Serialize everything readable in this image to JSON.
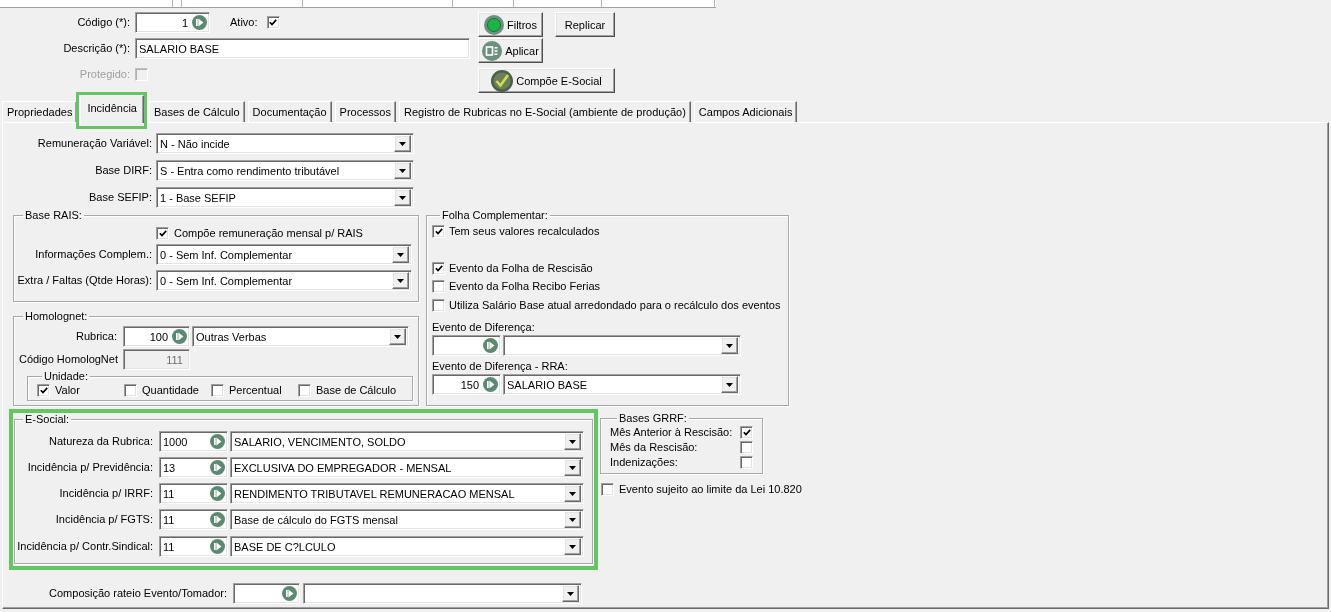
{
  "record": {
    "code": {
      "label": "Código (*):",
      "value": "1"
    },
    "active": {
      "label": "Ativo:",
      "checked": true
    },
    "description": {
      "label": "Descrição (*):",
      "value": "SALARIO BASE"
    },
    "protected": {
      "label": "Protegido:",
      "checked": false,
      "disabled": true
    }
  },
  "buttons": [
    {
      "label": "Filtros",
      "kind": "filter"
    },
    {
      "label": "Replicar",
      "kind": "plain"
    },
    {
      "label": "Aplicar",
      "kind": "apply"
    },
    {
      "label": "Compõe E-Social",
      "kind": "esocial"
    }
  ],
  "tabs": [
    {
      "label": "Propriedades",
      "selected": false,
      "highlighted": false
    },
    {
      "label": "Incidência",
      "selected": true,
      "highlighted": true
    },
    {
      "label": "Bases de Cálculo",
      "selected": false,
      "highlighted": false
    },
    {
      "label": "Documentação",
      "selected": false,
      "highlighted": false
    },
    {
      "label": "Processos",
      "selected": false,
      "highlighted": false
    },
    {
      "label": "Registro de Rubricas no E-Social (ambiente de produção)",
      "selected": false,
      "highlighted": false
    },
    {
      "label": "Campos Adicionais",
      "selected": false,
      "highlighted": false
    }
  ],
  "incidence": {
    "selects": [
      {
        "label": "Remuneração Variável:",
        "value": "N - Não incide"
      },
      {
        "label": "Base DIRF:",
        "value": "S - Entra como rendimento tributável"
      },
      {
        "label": "Base SEFIP:",
        "value": "1 - Base SEFIP"
      }
    ],
    "base_rais": {
      "title": "Base RAIS:",
      "checkbox": {
        "label": "Compõe remuneração mensal p/ RAIS",
        "checked": true
      },
      "selects": [
        {
          "label": "Informações Complem.:",
          "value": "0 - Sem Inf. Complementar"
        },
        {
          "label": "Extra / Faltas (Qtde Horas):",
          "value": "0 - Sem Inf. Complementar"
        }
      ]
    },
    "homolognet": {
      "title": "Homolognet:",
      "rubrica": {
        "label": "Rubrica:",
        "code": "100",
        "value": "Outras Verbas"
      },
      "homolognet_code": {
        "label": "Código HomologNet",
        "value": "111",
        "disabled": true
      },
      "unit": {
        "title": "Unidade:",
        "options": [
          {
            "label": "Valor",
            "checked": true
          },
          {
            "label": "Quantidade",
            "checked": false
          },
          {
            "label": "Percentual",
            "checked": false
          },
          {
            "label": "Base de Cálculo",
            "checked": false
          }
        ]
      }
    },
    "folha_complementar": {
      "title": "Folha Complementar:",
      "options": [
        {
          "label": "Tem seus valores recalculados",
          "checked": true
        },
        {
          "label": "Evento da Folha de Rescisão",
          "checked": true
        },
        {
          "label": "Evento da Folha Recibo Ferias",
          "checked": false
        },
        {
          "label": "Utiliza Salário Base atual arredondado para o recálculo dos eventos",
          "checked": false
        }
      ],
      "lookups": [
        {
          "label": "Evento de Diferença:"
        },
        {
          "label": "Evento de Diferença - RRA:",
          "code": "150",
          "value": "SALARIO BASE"
        }
      ]
    },
    "esocial": {
      "title": "E-Social:",
      "highlighted": true,
      "rows": [
        {
          "label": "Natureza da Rubrica:",
          "code": "1000",
          "value": "SALARIO, VENCIMENTO, SOLDO"
        },
        {
          "label": "Incidência p/ Previdência:",
          "code": "13",
          "value": "EXCLUSIVA DO EMPREGADOR - MENSAL"
        },
        {
          "label": "Incidência p/ IRRF:",
          "code": "11",
          "value": "RENDIMENTO TRIBUTAVEL REMUNERACAO MENSAL"
        },
        {
          "label": "Incidência p/ FGTS:",
          "code": "11",
          "value": "Base de cálculo do FGTS mensal"
        },
        {
          "label": "Incidência p/ Contr.Sindical:",
          "code": "11",
          "value": "BASE DE C?LCULO"
        }
      ]
    },
    "bases_grrf": {
      "title": "Bases GRRF:",
      "options": [
        {
          "label": "Mês Anterior à Rescisão:",
          "checked": true
        },
        {
          "label": "Mês da Rescisão:",
          "checked": false
        },
        {
          "label": "Indenizações:",
          "checked": false
        }
      ]
    },
    "lei_10820": {
      "label": "Evento sujeito ao limite da Lei 10.820",
      "checked": false
    },
    "composicao": {
      "label": "Composição rateio Evento/Tomador:"
    }
  }
}
